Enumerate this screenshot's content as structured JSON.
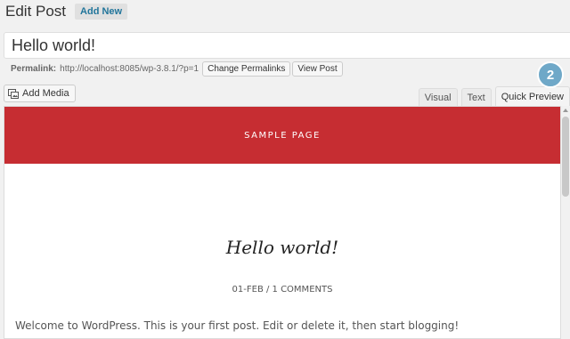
{
  "header": {
    "title": "Edit Post",
    "add_new_label": "Add New"
  },
  "title_field": {
    "value": "Hello world!"
  },
  "permalink": {
    "label": "Permalink:",
    "url": "http://localhost:8085/wp-3.8.1/?p=1",
    "change_label": "Change Permalinks",
    "view_label": "View Post"
  },
  "toolbar": {
    "add_media_label": "Add Media"
  },
  "tabs": [
    {
      "label": "Visual"
    },
    {
      "label": "Text"
    },
    {
      "label": "Quick Preview"
    }
  ],
  "badge": {
    "value": "2"
  },
  "preview": {
    "header_text": "SAMPLE PAGE",
    "post_title": "Hello world!",
    "meta": "01-FEB / 1 COMMENTS",
    "body": "Welcome to WordPress. This is your first post. Edit or delete it, then start blogging!"
  },
  "colors": {
    "accent": "#21759b",
    "header_red": "#c62d32",
    "badge": "#6fa8c8"
  }
}
